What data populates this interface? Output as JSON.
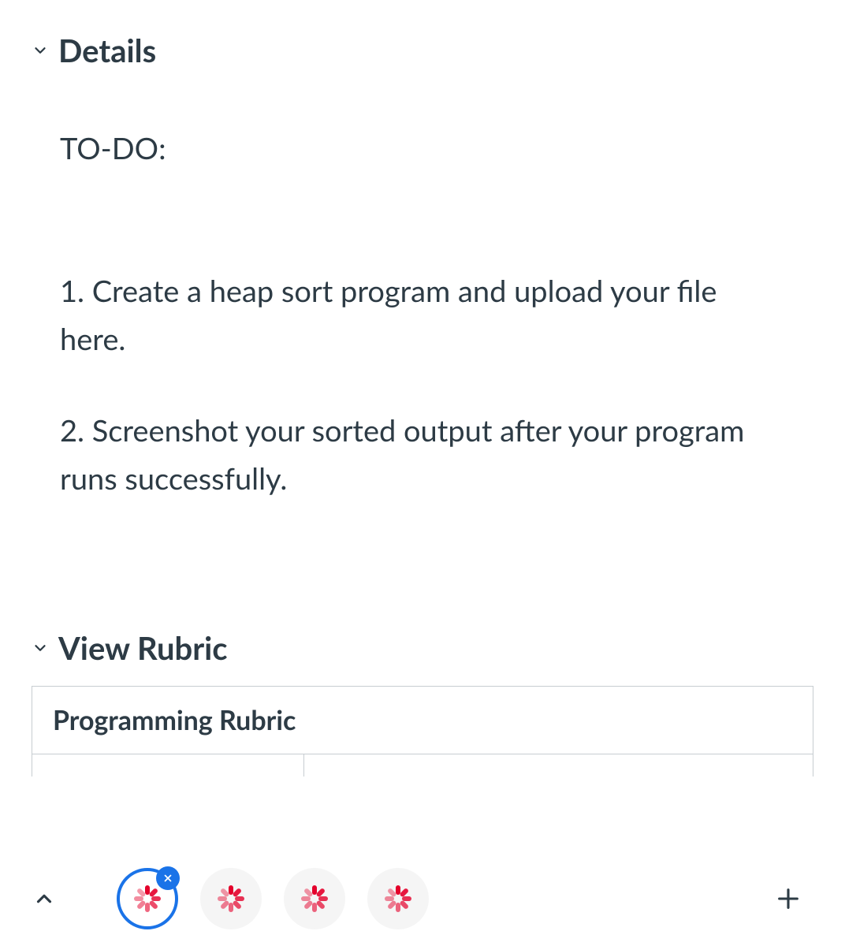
{
  "details": {
    "heading": "Details",
    "todo_label": "TO-DO:",
    "items": [
      "1. Create a  heap sort program and upload your file here.",
      "2. Screenshot your sorted output after your program runs successfully."
    ]
  },
  "rubric": {
    "toggle_label": "View Rubric",
    "title": "Programming Rubric"
  },
  "toolbar": {
    "tabs_count": 4,
    "active_tab_index": 0
  }
}
